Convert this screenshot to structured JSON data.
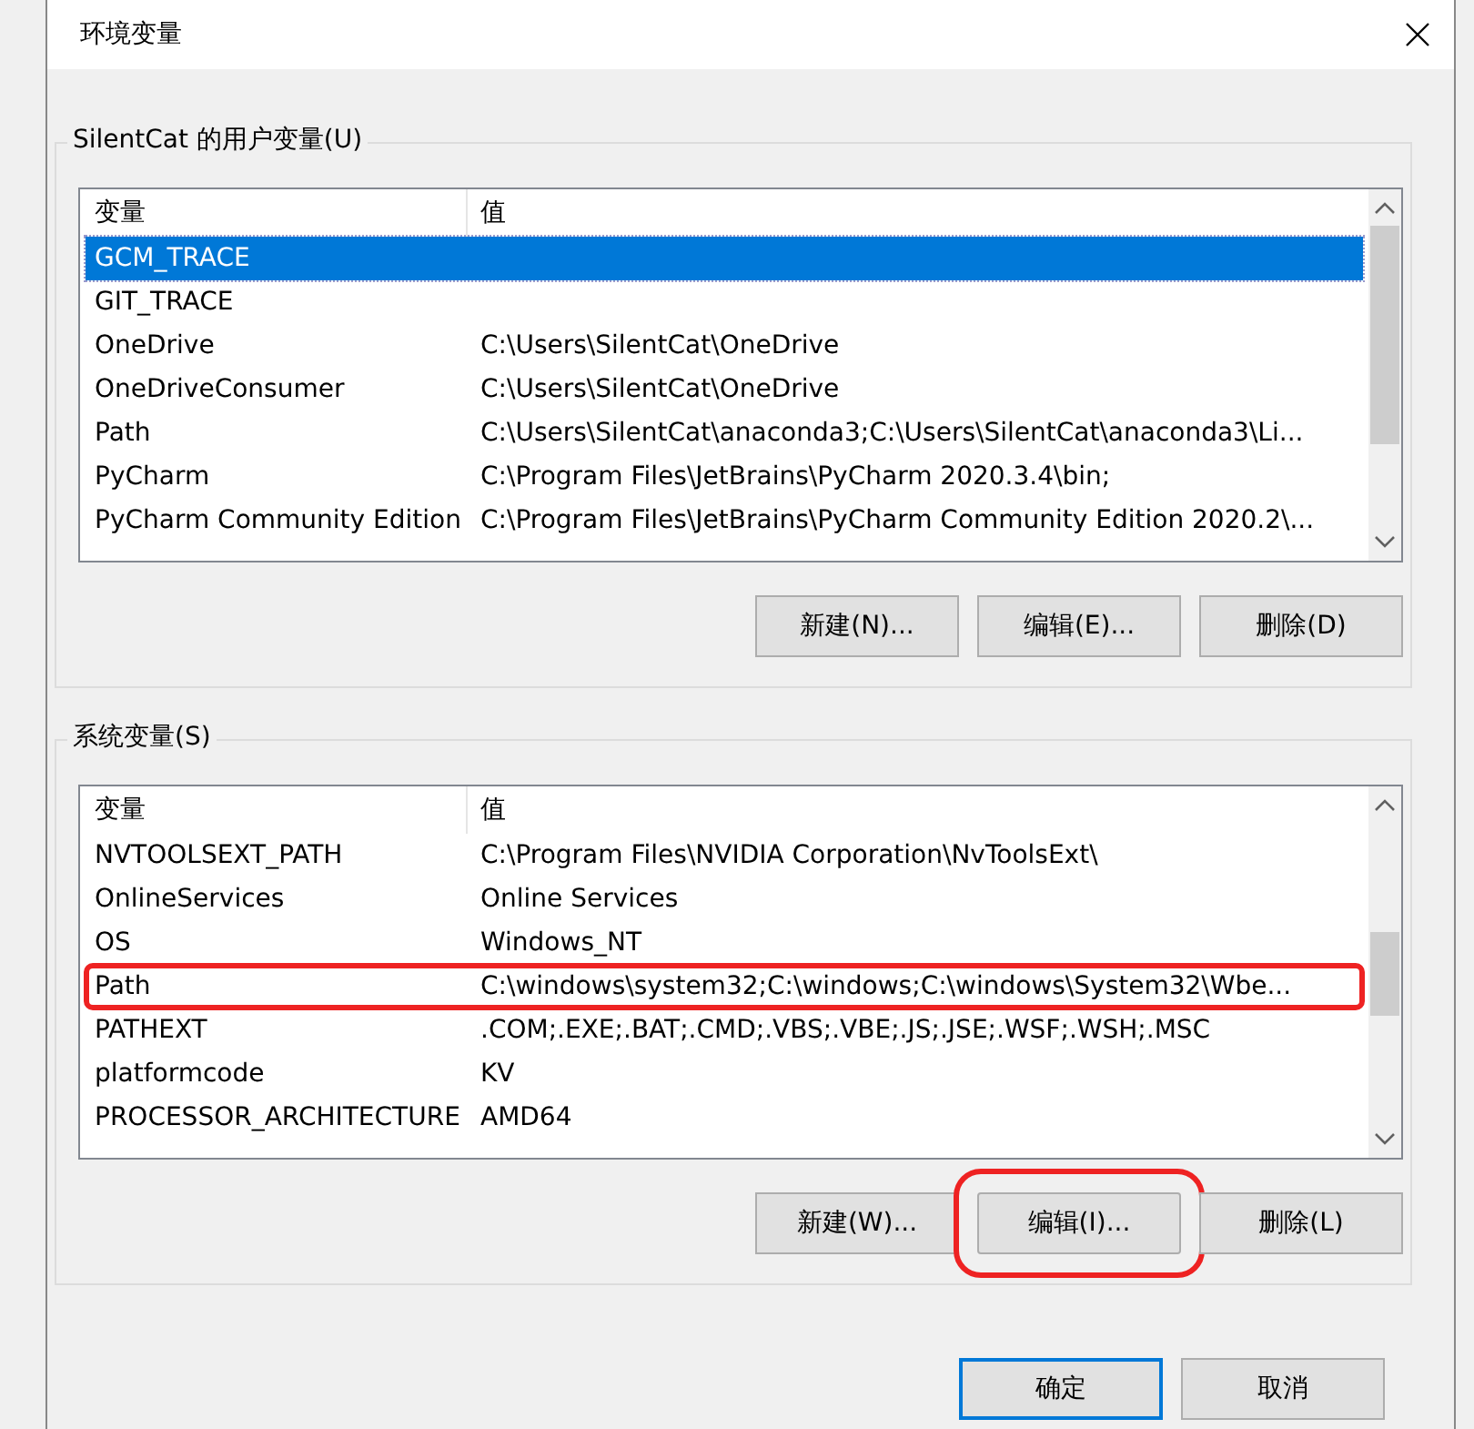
{
  "window": {
    "title": "环境变量"
  },
  "user_vars": {
    "title": "SilentCat 的用户变量(U)",
    "columns": [
      "变量",
      "值"
    ],
    "rows": [
      {
        "name": "GCM_TRACE",
        "value": "",
        "selected": true,
        "annotated": false
      },
      {
        "name": "GIT_TRACE",
        "value": "",
        "selected": false,
        "annotated": false
      },
      {
        "name": "OneDrive",
        "value": "C:\\Users\\SilentCat\\OneDrive",
        "selected": false,
        "annotated": false
      },
      {
        "name": "OneDriveConsumer",
        "value": "C:\\Users\\SilentCat\\OneDrive",
        "selected": false,
        "annotated": false
      },
      {
        "name": "Path",
        "value": "C:\\Users\\SilentCat\\anaconda3;C:\\Users\\SilentCat\\anaconda3\\Li...",
        "selected": false,
        "annotated": false
      },
      {
        "name": "PyCharm",
        "value": "C:\\Program Files\\JetBrains\\PyCharm 2020.3.4\\bin;",
        "selected": false,
        "annotated": false
      },
      {
        "name": "PyCharm Community Edition",
        "value": "C:\\Program Files\\JetBrains\\PyCharm Community Edition 2020.2\\...",
        "selected": false,
        "annotated": false
      }
    ],
    "buttons": [
      {
        "label": "新建(N)...",
        "annotated": false
      },
      {
        "label": "编辑(E)...",
        "annotated": false
      },
      {
        "label": "删除(D)",
        "annotated": false
      }
    ]
  },
  "system_vars": {
    "title": "系统变量(S)",
    "columns": [
      "变量",
      "值"
    ],
    "rows": [
      {
        "name": "NVTOOLSEXT_PATH",
        "value": "C:\\Program Files\\NVIDIA Corporation\\NvToolsExt\\",
        "selected": false,
        "annotated": false
      },
      {
        "name": "OnlineServices",
        "value": "Online Services",
        "selected": false,
        "annotated": false
      },
      {
        "name": "OS",
        "value": "Windows_NT",
        "selected": false,
        "annotated": false
      },
      {
        "name": "Path",
        "value": "C:\\windows\\system32;C:\\windows;C:\\windows\\System32\\Wbe...",
        "selected": false,
        "annotated": true
      },
      {
        "name": "PATHEXT",
        "value": ".COM;.EXE;.BAT;.CMD;.VBS;.VBE;.JS;.JSE;.WSF;.WSH;.MSC",
        "selected": false,
        "annotated": false
      },
      {
        "name": "platformcode",
        "value": "KV",
        "selected": false,
        "annotated": false
      },
      {
        "name": "PROCESSOR_ARCHITECTURE",
        "value": "AMD64",
        "selected": false,
        "annotated": false
      }
    ],
    "buttons": [
      {
        "label": "新建(W)...",
        "annotated": false
      },
      {
        "label": "编辑(I)...",
        "annotated": true
      },
      {
        "label": "删除(L)",
        "annotated": false
      }
    ]
  },
  "footer_buttons": [
    {
      "label": "确定",
      "default": true
    },
    {
      "label": "取消",
      "default": false
    }
  ]
}
